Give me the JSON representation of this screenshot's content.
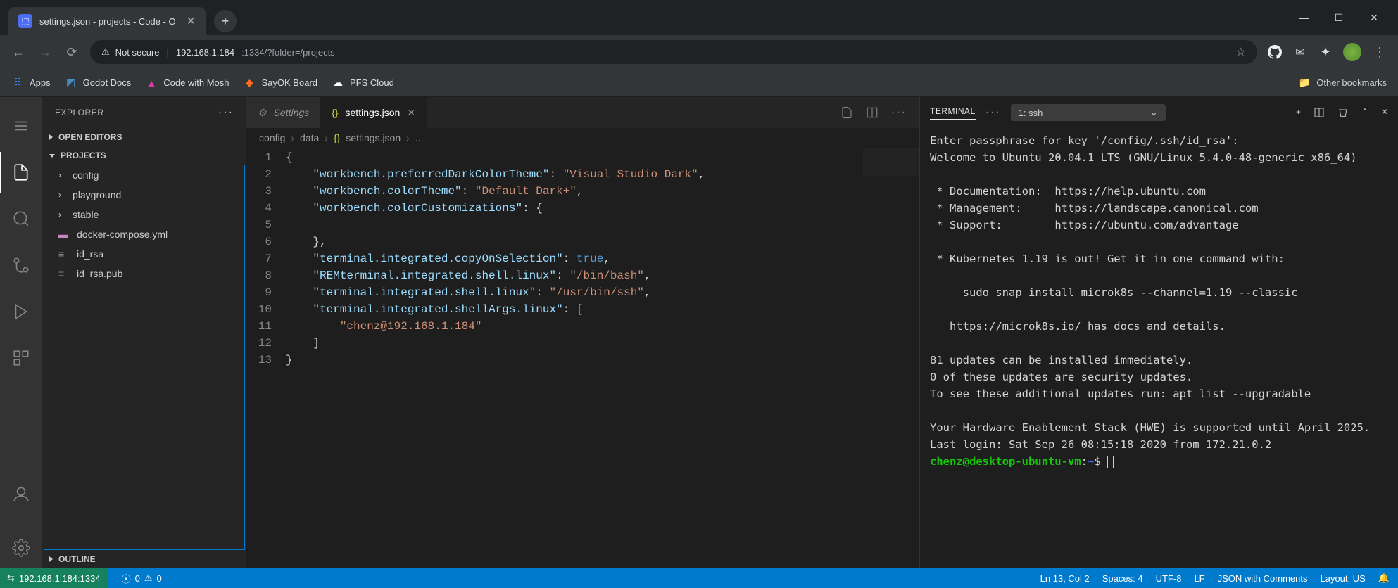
{
  "browser": {
    "tab_title": "settings.json - projects - Code - O",
    "address_not_secure": "Not secure",
    "address_host": "192.168.1.184",
    "address_path": ":1334/?folder=/projects",
    "bookmarks": [
      "Apps",
      "Godot Docs",
      "Code with Mosh",
      "SayOK Board",
      "PFS Cloud"
    ],
    "other_bookmarks": "Other bookmarks"
  },
  "sidebar": {
    "title": "EXPLORER",
    "open_editors": "OPEN EDITORS",
    "project": "PROJECTS",
    "outline": "OUTLINE",
    "items": [
      {
        "label": "config",
        "type": "folder"
      },
      {
        "label": "playground",
        "type": "folder"
      },
      {
        "label": "stable",
        "type": "folder"
      },
      {
        "label": "docker-compose.yml",
        "type": "file"
      },
      {
        "label": "id_rsa",
        "type": "file"
      },
      {
        "label": "id_rsa.pub",
        "type": "file"
      }
    ]
  },
  "tabs": {
    "settings": "Settings",
    "active": "settings.json"
  },
  "breadcrumb": [
    "config",
    "data",
    "settings.json",
    "..."
  ],
  "code": {
    "lines": [
      {
        "n": 1,
        "t": "{"
      },
      {
        "n": 2,
        "t": "    \"workbench.preferredDarkColorTheme\": \"Visual Studio Dark\","
      },
      {
        "n": 3,
        "t": "    \"workbench.colorTheme\": \"Default Dark+\","
      },
      {
        "n": 4,
        "t": "    \"workbench.colorCustomizations\": {"
      },
      {
        "n": 5,
        "t": ""
      },
      {
        "n": 6,
        "t": "    },"
      },
      {
        "n": 7,
        "t": "    \"terminal.integrated.copyOnSelection\": true,"
      },
      {
        "n": 8,
        "t": "    \"REMterminal.integrated.shell.linux\": \"/bin/bash\","
      },
      {
        "n": 9,
        "t": "    \"terminal.integrated.shell.linux\": \"/usr/bin/ssh\","
      },
      {
        "n": 10,
        "t": "    \"terminal.integrated.shellArgs.linux\": ["
      },
      {
        "n": 11,
        "t": "        \"chenz@192.168.1.184\""
      },
      {
        "n": 12,
        "t": "    ]"
      },
      {
        "n": 13,
        "t": "}"
      }
    ]
  },
  "terminal": {
    "label": "TERMINAL",
    "select": "1: ssh",
    "lines": [
      "Enter passphrase for key '/config/.ssh/id_rsa':",
      "Welcome to Ubuntu 20.04.1 LTS (GNU/Linux 5.4.0-48-generic x86_64)",
      "",
      " * Documentation:  https://help.ubuntu.com",
      " * Management:     https://landscape.canonical.com",
      " * Support:        https://ubuntu.com/advantage",
      "",
      " * Kubernetes 1.19 is out! Get it in one command with:",
      "",
      "     sudo snap install microk8s --channel=1.19 --classic",
      "",
      "   https://microk8s.io/ has docs and details.",
      "",
      "81 updates can be installed immediately.",
      "0 of these updates are security updates.",
      "To see these additional updates run: apt list --upgradable",
      "",
      "Your Hardware Enablement Stack (HWE) is supported until April 2025.",
      "Last login: Sat Sep 26 08:15:18 2020 from 172.21.0.2"
    ],
    "prompt_user": "chenz@desktop-ubuntu-vm",
    "prompt_path": "~"
  },
  "status": {
    "remote": "192.168.1.184:1334",
    "errors": "0",
    "warnings": "0",
    "cursor": "Ln 13, Col 2",
    "spaces": "Spaces: 4",
    "encoding": "UTF-8",
    "eol": "LF",
    "lang": "JSON with Comments",
    "layout": "Layout: US"
  }
}
